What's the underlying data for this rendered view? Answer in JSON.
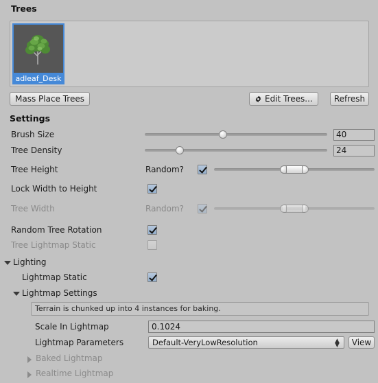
{
  "panel": {
    "trees_header": "Trees",
    "settings_header": "Settings"
  },
  "tree_list": {
    "items": [
      {
        "label": "adleaf_Desk",
        "selected": true,
        "icon": "tree-icon"
      }
    ]
  },
  "toolbar": {
    "mass_place_label": "Mass Place Trees",
    "edit_trees_label": "Edit Trees...",
    "edit_trees_icon": "gear-icon",
    "refresh_label": "Refresh"
  },
  "settings": {
    "brush_size": {
      "label": "Brush Size",
      "value": "40",
      "slider_pct": 33
    },
    "tree_density": {
      "label": "Tree Density",
      "value": "24",
      "slider_pct": 17
    },
    "tree_height": {
      "label": "Tree Height",
      "random_label": "Random?",
      "random_checked": true,
      "min_pct": 40,
      "max_pct": 53
    },
    "lock_width_to_height": {
      "label": "Lock Width to Height",
      "checked": true
    },
    "tree_width": {
      "label": "Tree Width",
      "random_label": "Random?",
      "random_checked": true,
      "disabled": true,
      "min_pct": 40,
      "max_pct": 53
    },
    "random_tree_rotation": {
      "label": "Random Tree Rotation",
      "checked": true
    },
    "tree_lightmap_static": {
      "label": "Tree Lightmap Static",
      "checked": false,
      "disabled": true
    }
  },
  "lighting": {
    "label": "Lighting",
    "expanded": true,
    "lightmap_static": {
      "label": "Lightmap Static",
      "checked": true
    },
    "lightmap_settings": {
      "label": "Lightmap Settings",
      "expanded": true,
      "help_text": "Terrain is chunked up into 4 instances for baking.",
      "scale_in_lightmap": {
        "label": "Scale In Lightmap",
        "value": "0.1024"
      },
      "lightmap_parameters": {
        "label": "Lightmap Parameters",
        "value": "Default-VeryLowResolution",
        "view_label": "View"
      },
      "baked_lightmap": {
        "label": "Baked Lightmap",
        "expanded": false
      },
      "realtime_lightmap": {
        "label": "Realtime Lightmap",
        "expanded": false
      }
    }
  },
  "colors": {
    "background": "#c2c2c2",
    "selection": "#4589d8",
    "checkbox_on": "#93aecb"
  }
}
